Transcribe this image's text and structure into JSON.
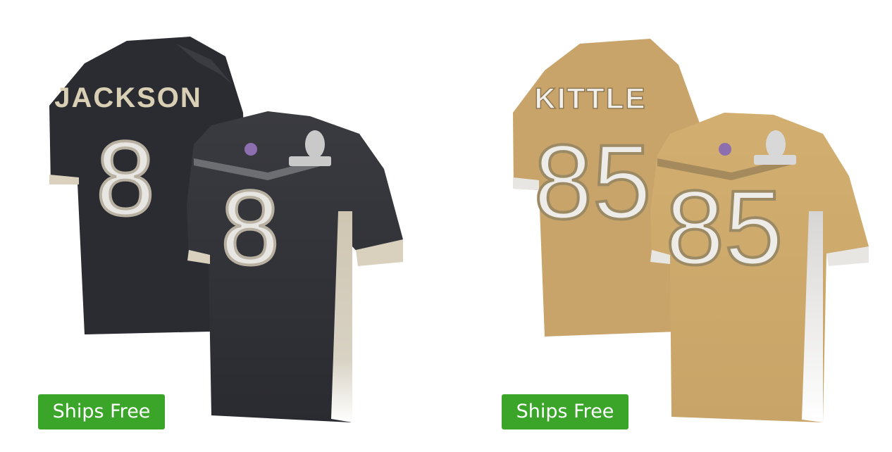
{
  "colors": {
    "badge_green": "#3ba52a",
    "black_jersey": "#2e2f34",
    "gold_jersey": "#c9a66a",
    "trim_cream": "#d9d1bd",
    "number_fill": "#e8e6e3"
  },
  "products": [
    {
      "back_name": "JACKSON",
      "number": "8",
      "badge_label": "Ships Free",
      "style": "black"
    },
    {
      "back_name": "KITTLE",
      "number": "85",
      "badge_label": "Ships Free",
      "style": "gold"
    }
  ]
}
